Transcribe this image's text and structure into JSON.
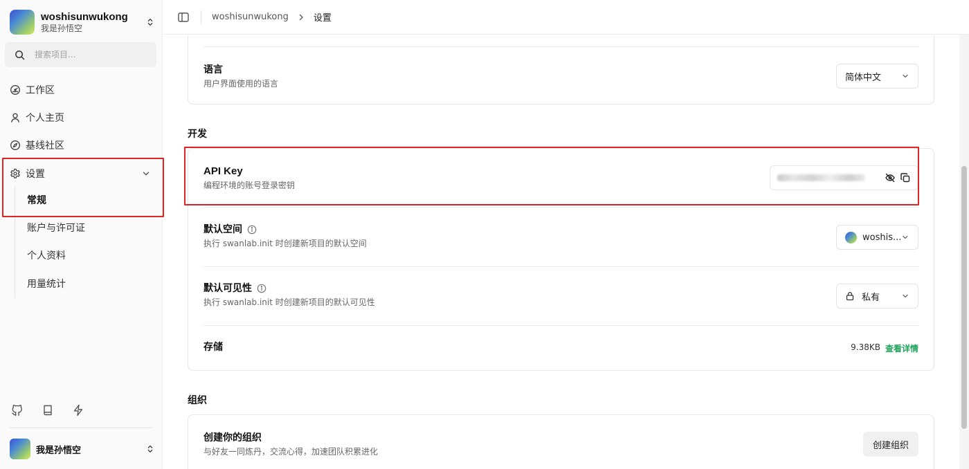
{
  "colors": {
    "accent_green": "#1fa35b",
    "highlight_red": "#e02424"
  },
  "sidebar": {
    "workspace": {
      "name": "woshisunwukong",
      "subtitle": "我是孙悟空",
      "switch_icon": "chevron-updown-icon"
    },
    "search": {
      "placeholder": "搜索项目...",
      "icon": "search-icon"
    },
    "nav": [
      {
        "label": "工作区",
        "icon": "dashboard-icon"
      },
      {
        "label": "个人主页",
        "icon": "user-icon"
      },
      {
        "label": "基线社区",
        "icon": "compass-icon"
      },
      {
        "label": "设置",
        "icon": "gear-icon",
        "expanded": true
      }
    ],
    "settings_sub": [
      {
        "label": "常规",
        "active": true
      },
      {
        "label": "账户与许可证"
      },
      {
        "label": "个人资料"
      },
      {
        "label": "用量统计"
      }
    ],
    "footer_icons": [
      "github-icon",
      "book-icon",
      "bolt-icon"
    ],
    "user": {
      "name": "我是孙悟空",
      "switch_icon": "chevron-updown-icon"
    }
  },
  "header": {
    "toggle_icon": "sidebar-toggle-icon",
    "breadcrumb": [
      "woshisunwukong",
      "设置"
    ]
  },
  "general": {
    "language": {
      "title": "语言",
      "desc": "用户界面使用的语言",
      "value": "简体中文"
    }
  },
  "dev": {
    "section_title": "开发",
    "api_key": {
      "title": "API Key",
      "desc": "编程环境的账号登录密钥",
      "hide_icon": "eye-off-icon",
      "copy_icon": "copy-icon"
    },
    "default_space": {
      "title": "默认空间",
      "desc": "执行 swanlab.init 时创建新项目的默认空间",
      "value": "woshis..."
    },
    "default_visibility": {
      "title": "默认可见性",
      "desc": "执行 swanlab.init 时创建新项目的默认可见性",
      "value": "私有"
    },
    "storage": {
      "title": "存储",
      "value": "9.38KB",
      "link": "查看详情"
    }
  },
  "org": {
    "section_title": "组织",
    "create": {
      "title": "创建你的组织",
      "desc": "与好友一同炼丹，交流心得，加速团队积累进化",
      "button": "创建组织"
    }
  }
}
